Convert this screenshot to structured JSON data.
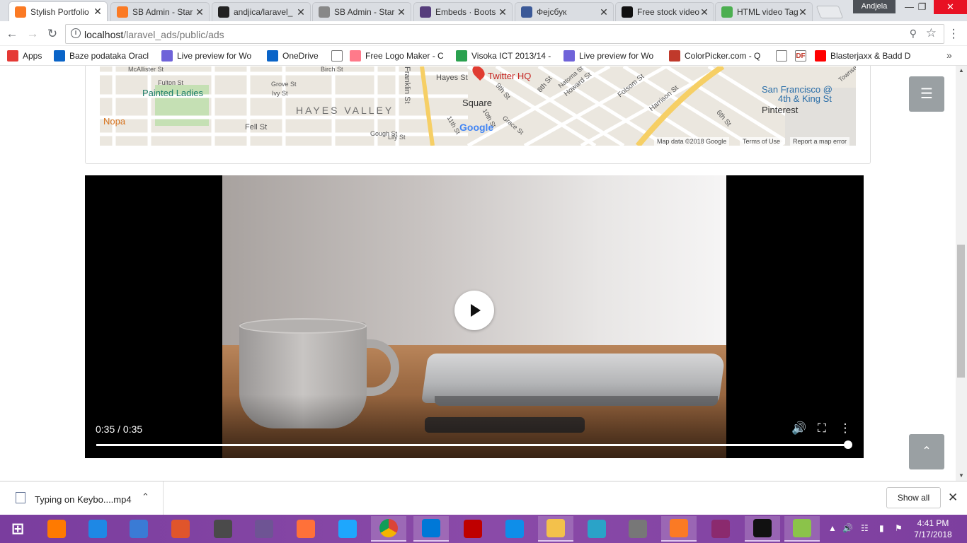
{
  "browser": {
    "tabs": [
      {
        "label": "Stylish Portfolio",
        "icon": "xampp-icon",
        "color": "#fb7a24",
        "active": true
      },
      {
        "label": "SB Admin - Star",
        "icon": "xampp-icon",
        "color": "#fb7a24"
      },
      {
        "label": "andjica/laravel_",
        "icon": "github-icon",
        "color": "#222222"
      },
      {
        "label": "SB Admin - Star",
        "icon": "page-icon",
        "color": "#888888"
      },
      {
        "label": "Embeds · Boots",
        "icon": "bootstrap-icon",
        "color": "#563d7c"
      },
      {
        "label": "Фејсбук",
        "icon": "facebook-icon",
        "color": "#3b5998"
      },
      {
        "label": "Free stock video",
        "icon": "video-icon",
        "color": "#111111"
      },
      {
        "label": "HTML video Tag",
        "icon": "w3schools-icon",
        "color": "#4caf50"
      }
    ],
    "profile": "Andjela",
    "url_host": "localhost",
    "url_path": "/laravel_ads/public/ads",
    "bookmarks": [
      {
        "label": "Apps",
        "icon": "apps-grid-icon"
      },
      {
        "label": "Baze podataka Oracl",
        "icon": "onedrive-icon"
      },
      {
        "label": "Live preview for Wo",
        "icon": "preview-icon"
      },
      {
        "label": "OneDrive",
        "icon": "onedrive-icon"
      },
      {
        "label": "",
        "icon": "page-icon"
      },
      {
        "label": "Free Logo Maker - C",
        "icon": "logo-maker-icon"
      },
      {
        "label": "Visoka ICT 2013/14 -",
        "icon": "drive-icon"
      },
      {
        "label": "Live preview for Wo",
        "icon": "preview-icon"
      },
      {
        "label": "ColorPicker.com - Q",
        "icon": "colorpicker-icon"
      },
      {
        "label": "",
        "icon": "page-icon"
      },
      {
        "label": "",
        "icon": "df-icon"
      },
      {
        "label": "Blasterjaxx & Badd D",
        "icon": "youtube-icon"
      }
    ]
  },
  "map": {
    "labels": [
      "Painted Ladies",
      "Nopa",
      "HAYES VALLEY",
      "Twitter HQ",
      "Square",
      "San Francisco @",
      "4th & King St",
      "Pinterest",
      "Fell St",
      "Hayes St",
      "Franklin St",
      "Grove St",
      "Ivy St",
      "Fulton St",
      "9th St",
      "8th St",
      "Howard St",
      "Folsom St",
      "Harrison St",
      "6th St",
      "Lily St",
      "Gough St",
      "11th St",
      "10th St",
      "Grace St",
      "Natoma St",
      "McAllister St",
      "Birch St",
      "Townsend"
    ],
    "footer": [
      "Map data ©2018 Google",
      "Terms of Use",
      "Report a map error"
    ],
    "logo": "Google"
  },
  "video": {
    "time": "0:35 / 0:35",
    "progress": 1.0
  },
  "download": {
    "filename": "Typing on Keybo....mp4",
    "show_all": "Show all"
  },
  "taskbar": {
    "time": "4:41 PM",
    "date": "7/17/2018",
    "apps": [
      {
        "name": "start-icon",
        "color": "#ffffff"
      },
      {
        "name": "avast-icon",
        "color": "#ff7a00"
      },
      {
        "name": "outlook-icon",
        "color": "#1e88e5"
      },
      {
        "name": "virtualbox-icon",
        "color": "#3a7bd5"
      },
      {
        "name": "phpstorm-icon",
        "color": "#e0552b"
      },
      {
        "name": "sublime-icon",
        "color": "#4a4a4a"
      },
      {
        "name": "github-desktop-icon",
        "color": "#6e5494"
      },
      {
        "name": "firefox-icon",
        "color": "#ff7139"
      },
      {
        "name": "ie-icon",
        "color": "#1ea7fd"
      },
      {
        "name": "chrome-icon",
        "color": "#4caf50"
      },
      {
        "name": "vscode-icon",
        "color": "#0078d7"
      },
      {
        "name": "filezilla-icon",
        "color": "#bf0000"
      },
      {
        "name": "teamviewer-icon",
        "color": "#0e8ee9"
      },
      {
        "name": "explorer-icon",
        "color": "#f3c14b"
      },
      {
        "name": "settings-icon",
        "color": "#2aa3c8"
      },
      {
        "name": "wampp-icon",
        "color": "#777777"
      },
      {
        "name": "xampp-icon",
        "color": "#fb7a24"
      },
      {
        "name": "winrar-icon",
        "color": "#8b2a6e"
      },
      {
        "name": "cmd-icon",
        "color": "#111111"
      },
      {
        "name": "notepadpp-icon",
        "color": "#8bc34a"
      }
    ]
  }
}
